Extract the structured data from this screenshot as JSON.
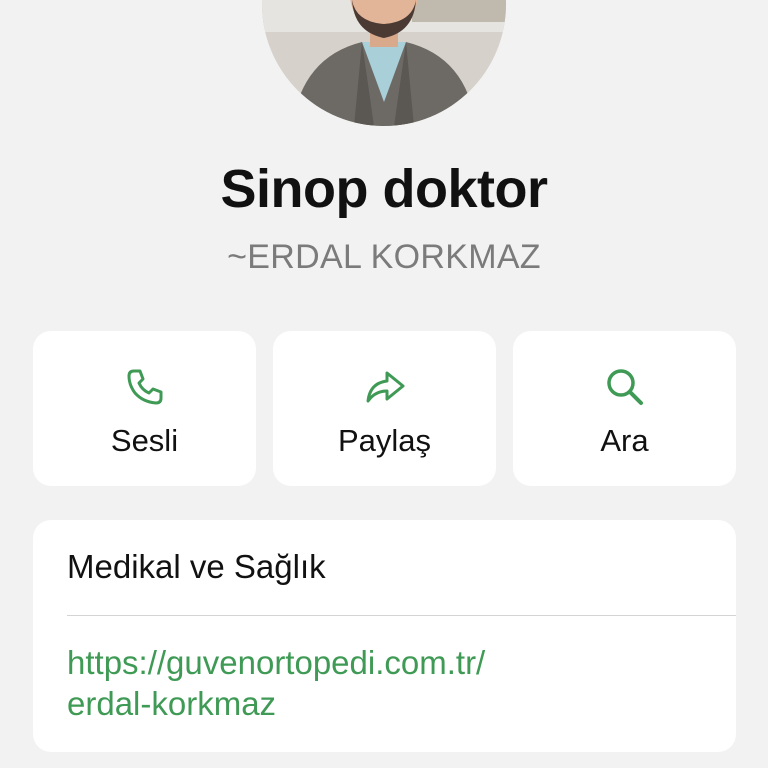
{
  "profile": {
    "title": "Sinop doktor",
    "subtitle": "~ERDAL KORKMAZ",
    "avatar_alt": "profile photo"
  },
  "actions": [
    {
      "label": "Sesli",
      "icon": "phone-icon"
    },
    {
      "label": "Paylaş",
      "icon": "share-icon"
    },
    {
      "label": "Ara",
      "icon": "search-icon"
    }
  ],
  "info": {
    "category": "Medikal ve Sağlık",
    "link_line1": "https://guvenortopedi.com.tr/",
    "link_line2": "erdal-korkmaz"
  },
  "colors": {
    "background": "#f2f2f2",
    "card": "#ffffff",
    "accent_green": "#3f9a55",
    "subtitle_gray": "#7b7b7b"
  }
}
